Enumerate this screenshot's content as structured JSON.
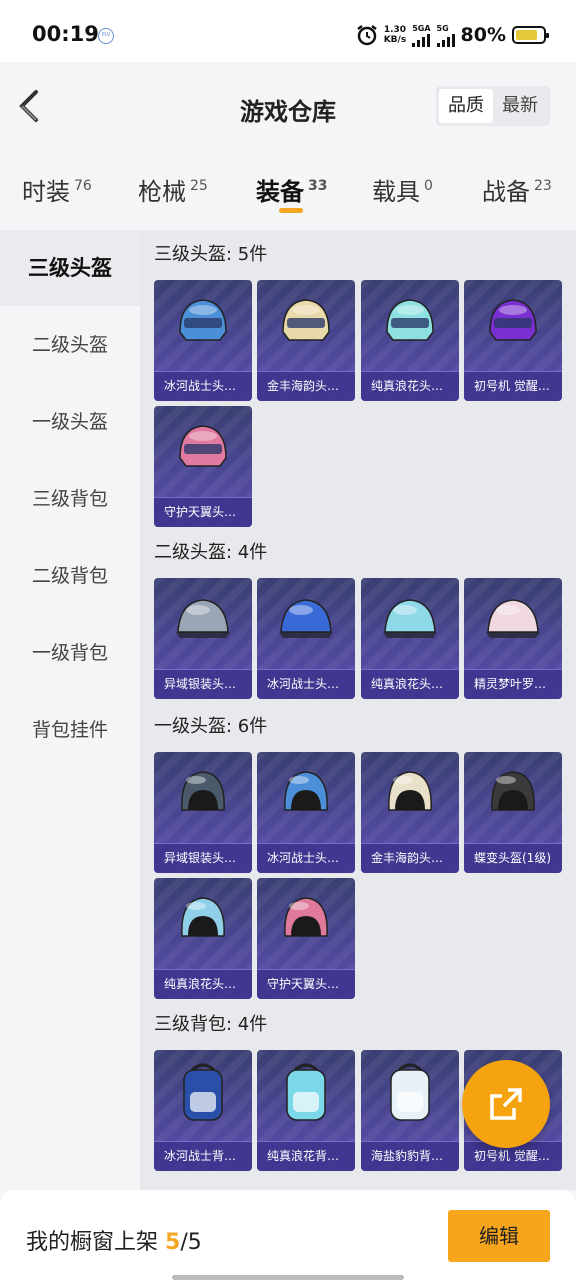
{
  "status_bar": {
    "time": "00:19",
    "speed_top": "1.30",
    "speed_bottom": "KB/s",
    "sim1": "5GA",
    "sim2": "5G",
    "battery_text": "80%",
    "battery_level": 0.8
  },
  "header": {
    "title": "游戏仓库",
    "sort_options": [
      "品质",
      "最新"
    ],
    "active_sort": "品质"
  },
  "tabs": [
    {
      "label": "时装",
      "count": "76"
    },
    {
      "label": "枪械",
      "count": "25"
    },
    {
      "label": "装备",
      "count": "33",
      "active": true
    },
    {
      "label": "载具",
      "count": "0"
    },
    {
      "label": "战备",
      "count": "23"
    }
  ],
  "sidebar": {
    "items": [
      "三级头盔",
      "二级头盔",
      "一级头盔",
      "三级背包",
      "二级背包",
      "一级背包",
      "背包挂件"
    ],
    "active": "三级头盔"
  },
  "sections": [
    {
      "title": "三级头盔: 5件",
      "items": [
        {
          "name": "冰河战士头…",
          "icon": "level3-helmet-icon",
          "color": "#4a8fd8"
        },
        {
          "name": "金丰海韵头…",
          "icon": "level3-helmet-icon",
          "color": "#e8d9a8"
        },
        {
          "name": "纯真浪花头…",
          "icon": "level3-helmet-icon",
          "color": "#8fe0e0"
        },
        {
          "name": "初号机 觉醒…",
          "icon": "level3-helmet-icon",
          "color": "#7a2fd0"
        },
        {
          "name": "守护天翼头…",
          "icon": "level3-helmet-icon",
          "color": "#e07aa0"
        }
      ]
    },
    {
      "title": "二级头盔: 4件",
      "items": [
        {
          "name": "异域银装头…",
          "icon": "level2-helmet-icon",
          "color": "#9aa6b5"
        },
        {
          "name": "冰河战士头…",
          "icon": "level2-helmet-icon",
          "color": "#3a6ad8"
        },
        {
          "name": "纯真浪花头…",
          "icon": "level2-helmet-icon",
          "color": "#8fd8e8"
        },
        {
          "name": "精灵梦叶罗…",
          "icon": "level2-helmet-icon",
          "color": "#f0d8e0"
        }
      ]
    },
    {
      "title": "一级头盔: 6件",
      "items": [
        {
          "name": "异域银装头…",
          "icon": "level1-helmet-icon",
          "color": "#4a5a6a"
        },
        {
          "name": "冰河战士头…",
          "icon": "level1-helmet-icon",
          "color": "#4a8fd8"
        },
        {
          "name": "金丰海韵头…",
          "icon": "level1-helmet-icon",
          "color": "#e8e0c8"
        },
        {
          "name": "蝶变头盔(1级)",
          "icon": "level1-helmet-icon",
          "color": "#3a3a3a"
        },
        {
          "name": "纯真浪花头…",
          "icon": "level1-helmet-icon",
          "color": "#8fd0e8"
        },
        {
          "name": "守护天翼头…",
          "icon": "level1-helmet-icon",
          "color": "#e07a9a"
        }
      ]
    },
    {
      "title": "三级背包: 4件",
      "items": [
        {
          "name": "冰河战士背…",
          "icon": "backpack-icon",
          "color": "#2a4fa8"
        },
        {
          "name": "纯真浪花背…",
          "icon": "backpack-icon",
          "color": "#7ad8e8"
        },
        {
          "name": "海盐豹豹背…",
          "icon": "backpack-icon",
          "color": "#e8f0f8"
        },
        {
          "name": "初号机 觉醒…",
          "icon": "backpack-icon",
          "color": "#6a2fb0"
        }
      ]
    }
  ],
  "bottom_bar": {
    "label": "我的橱窗上架",
    "count": "5",
    "total": "/5",
    "edit_label": "编辑"
  },
  "colors": {
    "accent": "#f5a623",
    "card_bg": "#4c4796"
  }
}
